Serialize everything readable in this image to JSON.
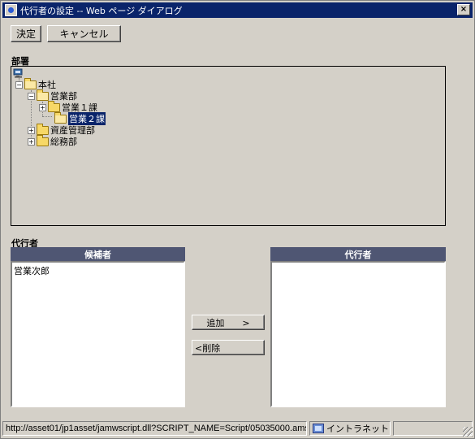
{
  "window": {
    "title": "代行者の設定 -- Web ページ ダイアログ",
    "close_label": "×"
  },
  "toolbar": {
    "decide_label": "決定",
    "cancel_label": "キャンセル"
  },
  "department": {
    "label": "部署",
    "tree": {
      "root": "本社",
      "nodes": [
        {
          "label": "営業部",
          "expanded": true
        },
        {
          "label": "営業１課",
          "expanded": false
        },
        {
          "label": "営業２課",
          "selected": true
        },
        {
          "label": "資産管理部",
          "expanded": false
        },
        {
          "label": "総務部",
          "expanded": false
        }
      ]
    }
  },
  "proxy": {
    "label": "代行者",
    "candidates_header": "候補者",
    "candidates": [
      "営業次郎"
    ],
    "proxies_header": "代行者",
    "proxies": [],
    "add_label": "追加　　>",
    "remove_label": "<削除"
  },
  "statusbar": {
    "url": "http://asset01/jp1asset/jamwscript.dll?SCRIPT_NAME=Script/05035000.ams",
    "zone": "イントラネット"
  },
  "colors": {
    "titlebar": "#0a246a",
    "list_header": "#4f5673",
    "face": "#d4d0c8",
    "selection": "#0a246a"
  }
}
